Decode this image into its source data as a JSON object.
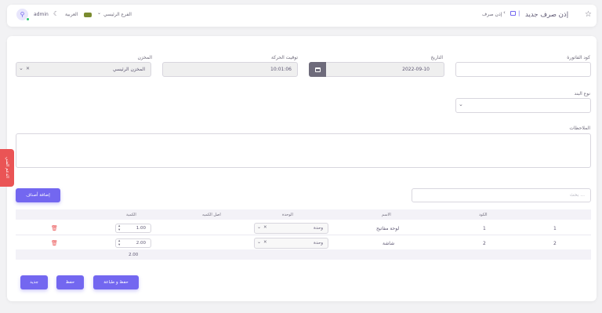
{
  "header": {
    "page_title": "إذن صرف جديد",
    "breadcrumb_item": "إذن صرف",
    "branch": "الفرع الرئيسي",
    "language": "العربية",
    "user": "admin"
  },
  "form": {
    "invoice_code_label": "كود الفاتورة",
    "date_label": "التاريخ",
    "date_value": "2022-09-10",
    "time_label": "توقيت الحركة",
    "time_value": "10:01:06",
    "warehouse_label": "المخزن",
    "warehouse_value": "المخزن الرئيسي",
    "item_type_label": "نوع البند",
    "notes_label": "الملاحظات",
    "search_placeholder": "بحث ...",
    "add_items_button": "إضافة أصناف"
  },
  "side_tab": "الدعم الفني",
  "table": {
    "headers": {
      "code": "الكود",
      "name": "الاسم",
      "unit": "الوحدة",
      "max_qty": "اصل الكميه",
      "qty": "الكمية"
    },
    "rows": [
      {
        "index": "1",
        "code": "1",
        "name": "لوحة مفاتيح",
        "unit": "وحدة",
        "qty": "1.00"
      },
      {
        "index": "2",
        "code": "2",
        "name": "شاشة",
        "unit": "وحدة",
        "qty": "2.00"
      }
    ],
    "total_qty": "2.00"
  },
  "footer": {
    "save_print": "حفظ و طباعة",
    "save": "حفظ",
    "new": "جديد"
  },
  "colors": {
    "primary": "#7367f0",
    "danger": "#ea5455",
    "online": "#28c76f"
  }
}
